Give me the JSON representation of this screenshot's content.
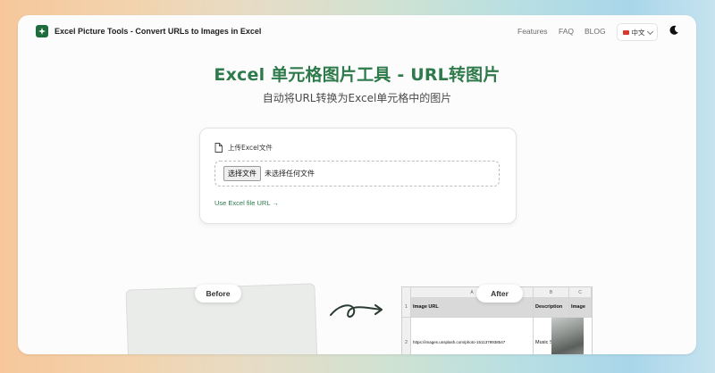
{
  "header": {
    "brand": "Excel Picture Tools - Convert URLs to Images in Excel",
    "nav": [
      "Features",
      "FAQ",
      "BLOG"
    ],
    "language": "中文"
  },
  "hero": {
    "title": "Excel 单元格图片工具 - URL转图片",
    "subtitle": "自动将URL转换为Excel单元格中的图片"
  },
  "upload": {
    "label": "上传Excel文件",
    "choose_button": "选择文件",
    "no_file": "未选择任何文件",
    "url_link": "Use Excel file URL →"
  },
  "comparison": {
    "before_label": "Before",
    "after_label": "After",
    "after_sheet": {
      "columns": [
        "A",
        "B",
        "C"
      ],
      "row_numbers": [
        "1",
        "2"
      ],
      "headers": [
        "Image URL",
        "Description",
        "Image"
      ],
      "row2": [
        "https://images.unsplash.com/photo-1511379938547",
        "Music Studio"
      ]
    }
  },
  "colors": {
    "brand_green": "#2e7a4b",
    "logo_green": "#1f6b3c"
  }
}
